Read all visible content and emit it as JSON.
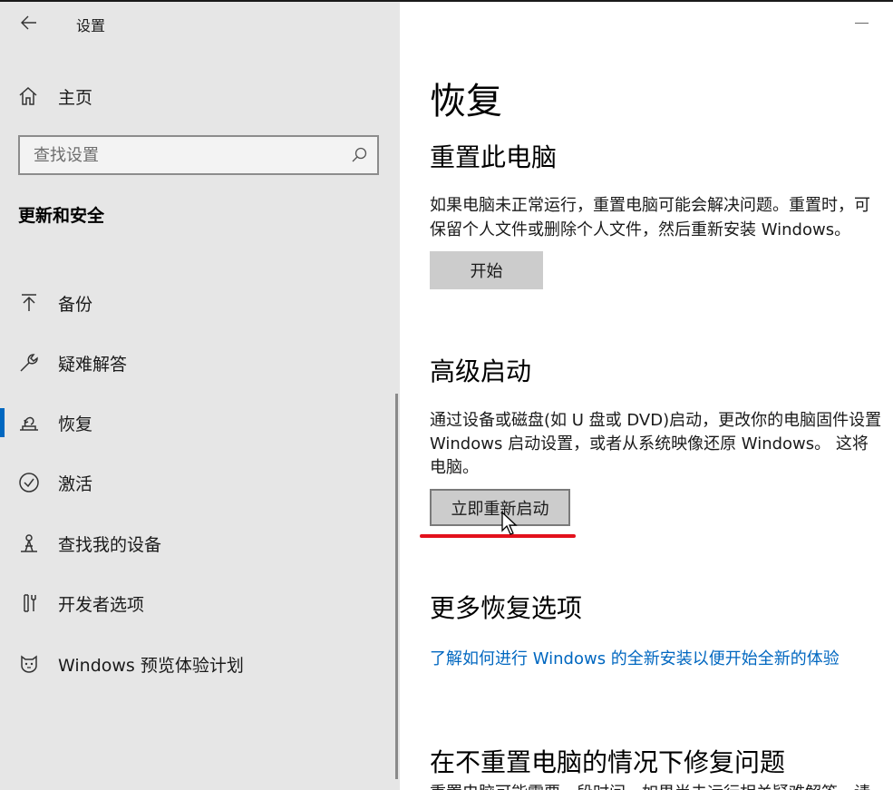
{
  "window": {
    "title": "设置"
  },
  "sidebar": {
    "home_label": "主页",
    "search_placeholder": "查找设置",
    "section_title": "更新和安全",
    "items": [
      {
        "label": "备份",
        "icon": "backup-icon"
      },
      {
        "label": "疑难解答",
        "icon": "wrench-icon"
      },
      {
        "label": "恢复",
        "icon": "recovery-icon",
        "active": true
      },
      {
        "label": "激活",
        "icon": "checkmark-circle-icon"
      },
      {
        "label": "查找我的设备",
        "icon": "find-device-icon"
      },
      {
        "label": "开发者选项",
        "icon": "developer-icon"
      },
      {
        "label": "Windows 预览体验计划",
        "icon": "insider-cat-icon"
      }
    ]
  },
  "main": {
    "page_title": "恢复",
    "reset": {
      "heading": "重置此电脑",
      "line1": "如果电脑未正常运行，重置电脑可能会解决问题。重置时，可",
      "line2": "保留个人文件或删除个人文件，然后重新安装 Windows。",
      "button": "开始"
    },
    "advanced": {
      "heading": "高级启动",
      "line1": "通过设备或磁盘(如 U 盘或 DVD)启动，更改你的电脑固件设置",
      "line2": "Windows 启动设置，或者从系统映像还原 Windows。 这将",
      "line3": "电脑。",
      "button": "立即重新启动"
    },
    "more": {
      "heading": "更多恢复选项",
      "link": "了解如何进行 Windows 的全新安装以便开始全新的体验"
    },
    "fix": {
      "heading": "在不重置电脑的情况下修复问题",
      "partial_text": "重置电脑可能需要一段时间。如果尚未运行相关疑难解答，请"
    }
  },
  "colors": {
    "accent": "#0067c0",
    "sidebar_bg": "#e6e6e6",
    "button_bg": "#cccccc",
    "annotation_red": "#e3111c"
  }
}
